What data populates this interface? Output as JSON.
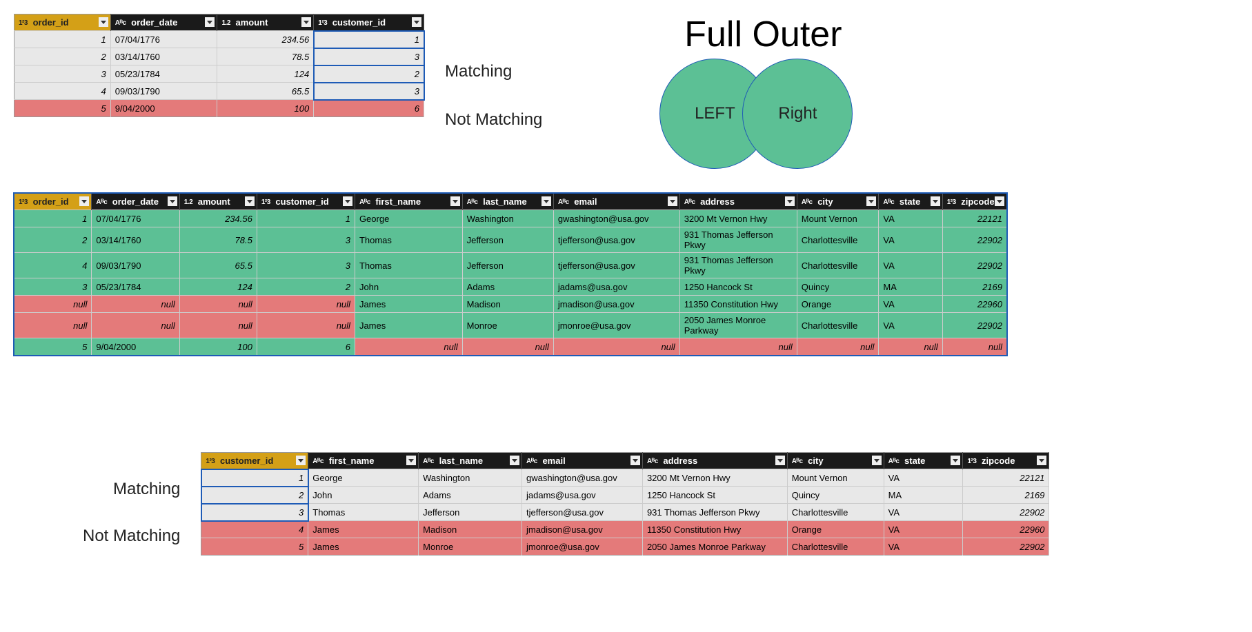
{
  "labels": {
    "matching": "Matching",
    "not_matching": "Not Matching",
    "title": "Full Outer",
    "left": "LEFT",
    "right": "Right"
  },
  "type_icons": {
    "int": "1²3",
    "text": "Aᴮc",
    "dec": "1.2"
  },
  "orders": {
    "headers": [
      "order_id",
      "order_date",
      "amount",
      "customer_id"
    ],
    "types": [
      "int",
      "text",
      "dec",
      "int"
    ],
    "rows": [
      {
        "order_id": 1,
        "order_date": "07/04/1776",
        "amount": 234.56,
        "customer_id": 1,
        "match": true
      },
      {
        "order_id": 2,
        "order_date": "03/14/1760",
        "amount": 78.5,
        "customer_id": 3,
        "match": true
      },
      {
        "order_id": 3,
        "order_date": "05/23/1784",
        "amount": 124,
        "customer_id": 2,
        "match": true
      },
      {
        "order_id": 4,
        "order_date": "09/03/1790",
        "amount": 65.5,
        "customer_id": 3,
        "match": true
      },
      {
        "order_id": 5,
        "order_date": "9/04/2000",
        "amount": 100,
        "customer_id": 6,
        "match": false
      }
    ]
  },
  "customers": {
    "headers": [
      "customer_id",
      "first_name",
      "last_name",
      "email",
      "address",
      "city",
      "state",
      "zipcode"
    ],
    "types": [
      "int",
      "text",
      "text",
      "text",
      "text",
      "text",
      "text",
      "int"
    ],
    "rows": [
      {
        "customer_id": 1,
        "first_name": "George",
        "last_name": "Washington",
        "email": "gwashington@usa.gov",
        "address": "3200 Mt Vernon Hwy",
        "city": "Mount Vernon",
        "state": "VA",
        "zipcode": 22121,
        "match": true
      },
      {
        "customer_id": 2,
        "first_name": "John",
        "last_name": "Adams",
        "email": "jadams@usa.gov",
        "address": "1250 Hancock St",
        "city": "Quincy",
        "state": "MA",
        "zipcode": 2169,
        "match": true
      },
      {
        "customer_id": 3,
        "first_name": "Thomas",
        "last_name": "Jefferson",
        "email": "tjefferson@usa.gov",
        "address": "931 Thomas Jefferson Pkwy",
        "city": "Charlottesville",
        "state": "VA",
        "zipcode": 22902,
        "match": true
      },
      {
        "customer_id": 4,
        "first_name": "James",
        "last_name": "Madison",
        "email": "jmadison@usa.gov",
        "address": "11350 Constitution Hwy",
        "city": "Orange",
        "state": "VA",
        "zipcode": 22960,
        "match": false
      },
      {
        "customer_id": 5,
        "first_name": "James",
        "last_name": "Monroe",
        "email": "jmonroe@usa.gov",
        "address": "2050 James Monroe Parkway",
        "city": "Charlottesville",
        "state": "VA",
        "zipcode": 22902,
        "match": false
      }
    ]
  },
  "full_outer": {
    "headers": [
      "order_id",
      "order_date",
      "amount",
      "customer_id",
      "first_name",
      "last_name",
      "email",
      "address",
      "city",
      "state",
      "zipcode"
    ],
    "types": [
      "int",
      "text",
      "dec",
      "int",
      "text",
      "text",
      "text",
      "text",
      "text",
      "text",
      "int"
    ],
    "rows": [
      {
        "cells": [
          1,
          "07/04/1776",
          234.56,
          1,
          "George",
          "Washington",
          "gwashington@usa.gov",
          "3200 Mt Vernon Hwy",
          "Mount Vernon",
          "VA",
          22121
        ],
        "left": "green",
        "right": "green"
      },
      {
        "cells": [
          2,
          "03/14/1760",
          78.5,
          3,
          "Thomas",
          "Jefferson",
          "tjefferson@usa.gov",
          "931 Thomas Jefferson Pkwy",
          "Charlottesville",
          "VA",
          22902
        ],
        "left": "green",
        "right": "green"
      },
      {
        "cells": [
          4,
          "09/03/1790",
          65.5,
          3,
          "Thomas",
          "Jefferson",
          "tjefferson@usa.gov",
          "931 Thomas Jefferson Pkwy",
          "Charlottesville",
          "VA",
          22902
        ],
        "left": "green",
        "right": "green"
      },
      {
        "cells": [
          3,
          "05/23/1784",
          124,
          2,
          "John",
          "Adams",
          "jadams@usa.gov",
          "1250 Hancock St",
          "Quincy",
          "MA",
          2169
        ],
        "left": "green",
        "right": "green"
      },
      {
        "cells": [
          "null",
          "null",
          "null",
          "null",
          "James",
          "Madison",
          "jmadison@usa.gov",
          "11350 Constitution Hwy",
          "Orange",
          "VA",
          22960
        ],
        "left": "red",
        "right": "green"
      },
      {
        "cells": [
          "null",
          "null",
          "null",
          "null",
          "James",
          "Monroe",
          "jmonroe@usa.gov",
          "2050 James Monroe Parkway",
          "Charlottesville",
          "VA",
          22902
        ],
        "left": "red",
        "right": "green"
      },
      {
        "cells": [
          5,
          "9/04/2000",
          100,
          6,
          "null",
          "null",
          "null",
          "null",
          "null",
          "null",
          "null"
        ],
        "left": "green",
        "right": "red"
      }
    ]
  }
}
